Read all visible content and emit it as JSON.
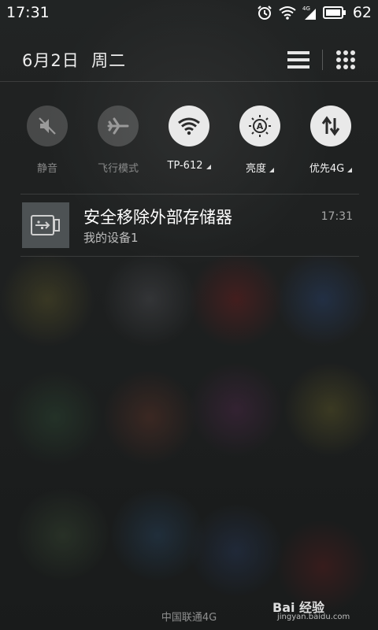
{
  "status_bar": {
    "time": "17:31",
    "network_type": "4G",
    "battery_level": "62"
  },
  "header": {
    "date": "6月2日",
    "weekday": "周二"
  },
  "quick_toggles": [
    {
      "label": "静音",
      "icon": "mute-icon",
      "state": "off",
      "has_menu": false
    },
    {
      "label": "飞行模式",
      "icon": "airplane-icon",
      "state": "off",
      "has_menu": false
    },
    {
      "label": "TP-612",
      "icon": "wifi-icon",
      "state": "on",
      "has_menu": true
    },
    {
      "label": "亮度",
      "icon": "brightness-auto-icon",
      "state": "on",
      "has_menu": true
    },
    {
      "label": "优先4G",
      "icon": "data-transfer-icon",
      "state": "on",
      "has_menu": true
    }
  ],
  "notification": {
    "title": "安全移除外部存储器",
    "subtitle": "我的设备1",
    "time": "17:31",
    "icon": "usb-icon"
  },
  "footer": {
    "carrier": "中国联通4G",
    "watermark": "Bai 经验",
    "watermark_sub": "jingyan.baidu.com"
  }
}
